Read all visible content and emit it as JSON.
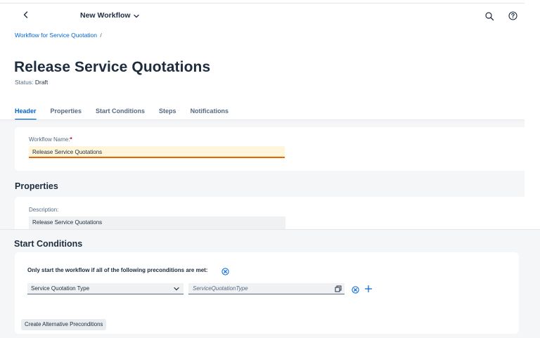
{
  "shell": {
    "workflow_title": "New Workflow"
  },
  "breadcrumb": {
    "link": "Workflow for Service Quotation",
    "separator": "/"
  },
  "page": {
    "title": "Release Service Quotations",
    "status_label": "Status:",
    "status_value": "Draft"
  },
  "tabs": [
    {
      "label": "Header",
      "active": true
    },
    {
      "label": "Properties"
    },
    {
      "label": "Start Conditions"
    },
    {
      "label": "Steps"
    },
    {
      "label": "Notifications"
    }
  ],
  "header_section": {
    "workflow_name_label": "Workflow Name:",
    "required_marker": "*",
    "workflow_name_value": "Release Service Quotations"
  },
  "properties_section": {
    "title": "Properties",
    "description_label": "Description:",
    "description_value": "Release Service Quotations"
  },
  "start_conditions": {
    "title": "Start Conditions",
    "precondition_text": "Only start the workflow if all of the following preconditions are met:",
    "condition_field": "Service Quotation Type",
    "condition_value_placeholder": "ServiceQuotationType",
    "alt_button": "Create Alternative Preconditions"
  },
  "icons": [
    "back-icon",
    "chevron-down-icon",
    "search-icon",
    "help-icon",
    "clear-icon",
    "value-help-icon",
    "add-icon"
  ],
  "colors": {
    "accent": "#0064d9",
    "warning_bg": "#fff6dc",
    "warning_border": "#e76500",
    "text": "#1d2d3e"
  }
}
